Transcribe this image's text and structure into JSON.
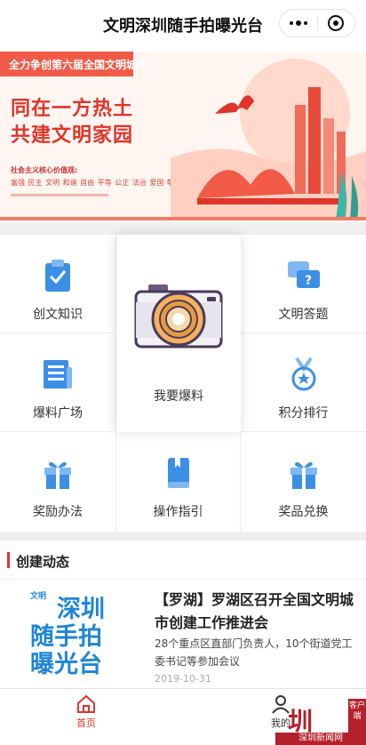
{
  "header": {
    "title": "文明深圳随手拍曝光台",
    "more_icon": "more-dots-icon",
    "close_icon": "miniprogram-close-icon"
  },
  "banner": {
    "tag": "全力争创第六届全国文明城市",
    "line1": "同在一方热土",
    "line2": "共建文明家园",
    "values_label": "社会主义核心价值观:",
    "values": "富强 民主 文明 和谐 自由 平等 公正 法治 爱国 敬业 诚信 友善",
    "accent": "#e0342a"
  },
  "grid": {
    "items": [
      {
        "label": "创文知识",
        "icon": "clipboard-check-icon"
      },
      {
        "label": "文明答题",
        "icon": "chat-question-icon"
      },
      {
        "label": "爆料广场",
        "icon": "newspaper-icon"
      },
      {
        "label": "积分排行",
        "icon": "medal-icon"
      },
      {
        "label": "奖励办法",
        "icon": "gift-icon"
      },
      {
        "label": "操作指引",
        "icon": "book-icon"
      },
      {
        "label": "奖品兑换",
        "icon": "gift-box-icon"
      }
    ],
    "featured": {
      "label": "我要爆料",
      "icon": "camera-icon"
    },
    "icon_color": "#3d8fe5"
  },
  "news": {
    "section_title": "创建动态",
    "items": [
      {
        "logo_small": "文明",
        "logo_l1": "深圳",
        "logo_l2": "随手拍",
        "logo_l3": "曝光台",
        "title": "【罗湖】罗湖区召开全国文明城市创建工作推进会",
        "desc": "28个重点区直部门负责人，10个街道党工委书记等参加会议",
        "date": "2019-10-31"
      }
    ]
  },
  "tabbar": {
    "tabs": [
      {
        "label": "首页",
        "icon": "home-icon",
        "active": true
      },
      {
        "label": "我的",
        "icon": "user-icon",
        "active": false
      }
    ],
    "active_color": "#e0342a"
  },
  "watermark": {
    "logo": "圳",
    "tag": "客户端",
    "name": "深圳新闻网"
  }
}
